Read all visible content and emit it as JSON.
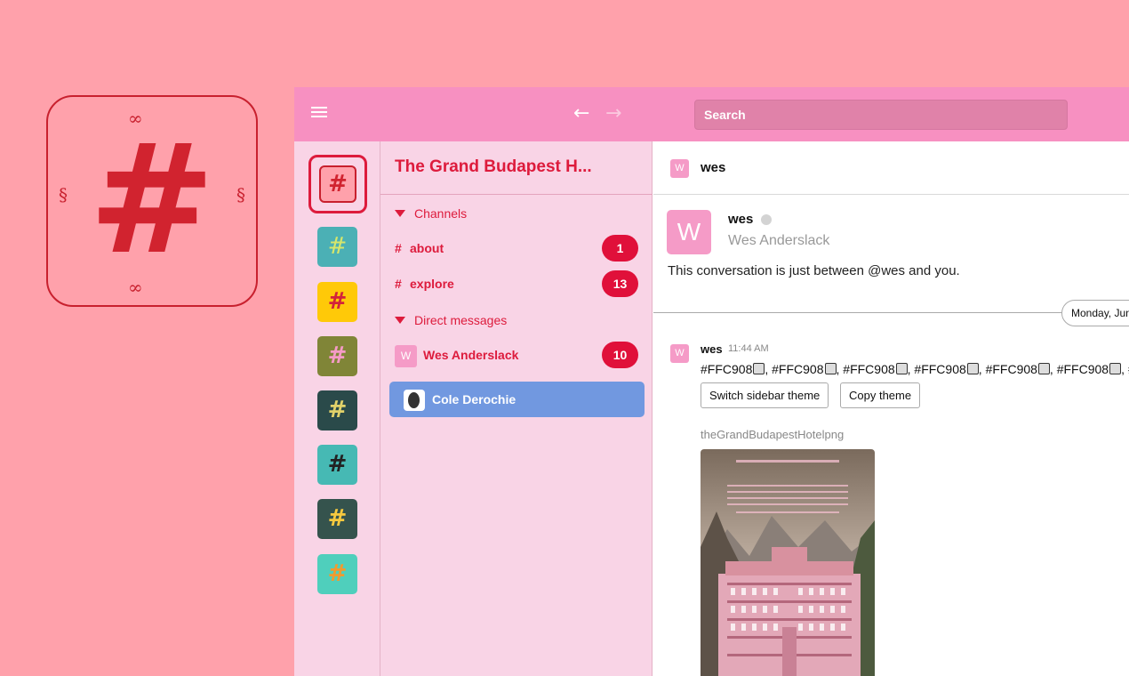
{
  "logo": {
    "glyph": "#"
  },
  "topbar": {
    "back_arrow": "←",
    "forward_arrow": "→",
    "search_placeholder": "Search"
  },
  "teams": [
    {
      "name": "The Grand Budapest Hotel",
      "glyph": "#",
      "color": "#ffa1ab"
    },
    {
      "glyph": "#",
      "color": "#4bb0b5"
    },
    {
      "glyph": "#",
      "color": "#ffc908"
    },
    {
      "glyph": "#",
      "color": "#808537"
    },
    {
      "glyph": "#",
      "color": "#2a4a4a"
    },
    {
      "glyph": "#",
      "color": "#46b9b4"
    },
    {
      "glyph": "#",
      "color": "#35534d"
    },
    {
      "glyph": "#",
      "color": "#4fcfbc"
    }
  ],
  "sidebar": {
    "team_name": "The Grand Budapest H...",
    "channels_label": "Channels",
    "channels": [
      {
        "hash": "#",
        "name": "about",
        "badge": "1"
      },
      {
        "hash": "#",
        "name": "explore",
        "badge": "13"
      }
    ],
    "dm_label": "Direct messages",
    "dms": [
      {
        "avatar": "W",
        "name": "Wes Anderslack",
        "badge": "10"
      },
      {
        "name": "Cole Derochie"
      }
    ]
  },
  "channel": {
    "avatar": "W",
    "title": "wes",
    "intro_name": "wes",
    "intro_fullname": "Wes Anderslack",
    "intro_text": "This conversation is just between @wes and you.",
    "day_label": "Monday, June",
    "message": {
      "author": "wes",
      "time": "11:44 AM",
      "colors": [
        "#FFC908",
        "#FFC908",
        "#FFC908",
        "#FFC908",
        "#FFC908",
        "#FFC908"
      ],
      "tail": "#",
      "switch_button": "Switch sidebar theme",
      "copy_button": "Copy theme",
      "file_name": "theGrandBudapestHotelpng"
    }
  },
  "colors": {
    "background": "#ffa1ab",
    "topbar": "#f790c1",
    "sidebar": "#f9d4e6",
    "accent": "#dd1b3c",
    "active": "#7198e0"
  }
}
